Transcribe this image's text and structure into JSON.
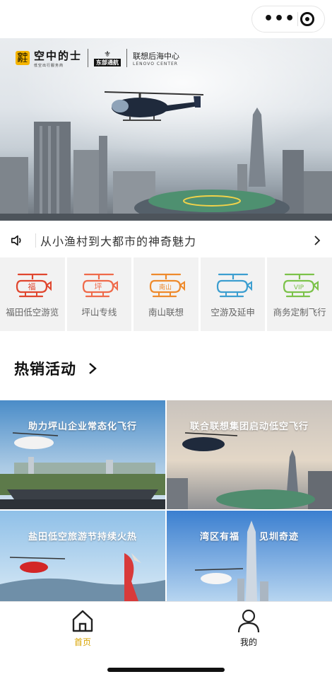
{
  "capsule": {
    "more_icon": "more-dots-icon",
    "close_icon": "target-icon"
  },
  "hero": {
    "brand_badge": "空中的士",
    "brand_main": "空中的士",
    "brand_sub": "低空出行服务商",
    "brand2_text": "东部通航",
    "brand3_cn": "联想后海中心",
    "brand3_en": "LENOVO CENTER"
  },
  "notice": {
    "text": "从小渔村到大都市的神奇魅力",
    "icon": "speaker-icon",
    "arrow_icon": "chevron-right-icon"
  },
  "categories": [
    {
      "label": "福田低空游览",
      "badge": "福",
      "color": "#e0462e"
    },
    {
      "label": "坪山专线",
      "badge": "坪",
      "color": "#ef6a4a"
    },
    {
      "label": "南山联想",
      "badge": "南山",
      "color": "#ee8a2c"
    },
    {
      "label": "空游及延申",
      "badge": "",
      "color": "#3c9ed0"
    },
    {
      "label": "商务定制飞行",
      "badge": "VIP",
      "color": "#7cc24a"
    }
  ],
  "section": {
    "title": "热销活动"
  },
  "activities": [
    {
      "title": "助力坪山企业常态化飞行"
    },
    {
      "title": "联合联想集团启动低空飞行"
    },
    {
      "title": "盐田低空旅游节持续火热"
    },
    {
      "title": "湾区有福　　见圳奇迹"
    }
  ],
  "tabbar": {
    "home_label": "首页",
    "mine_label": "我的",
    "active_color": "#d9a400"
  }
}
